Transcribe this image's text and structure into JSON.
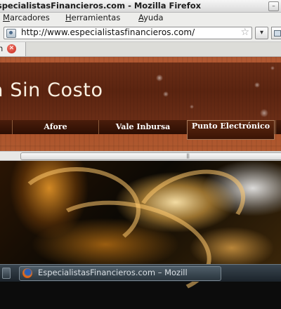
{
  "window": {
    "title": "EspecialistasFinancieros.com - Mozilla Firefox",
    "buttons": [
      "–",
      "□",
      "✕"
    ]
  },
  "menu": {
    "items": [
      "Marcadores",
      "Herramientas",
      "Ayuda"
    ],
    "mnemonics": [
      "M",
      "H",
      "A"
    ]
  },
  "navbar": {
    "url": "http://www.especialistasfinancieros.com/",
    "dropdown_glyph": "▾",
    "star_glyph": "☆"
  },
  "tab": {
    "label": "n",
    "close_glyph": "✕"
  },
  "site": {
    "banner_title": "a Sin Costo",
    "nav_items": [
      "",
      "Afore",
      "Vale Inbursa",
      "Punto Electrónico",
      ""
    ]
  },
  "scrollbar": {
    "grip": "|||"
  },
  "taskbar": {
    "task_label": "EspecialistasFinancieros.com – Mozill"
  },
  "colors": {
    "banner_dark": "#5b2410",
    "nav_bg": "#3b1405",
    "wood": "#a24a25"
  }
}
